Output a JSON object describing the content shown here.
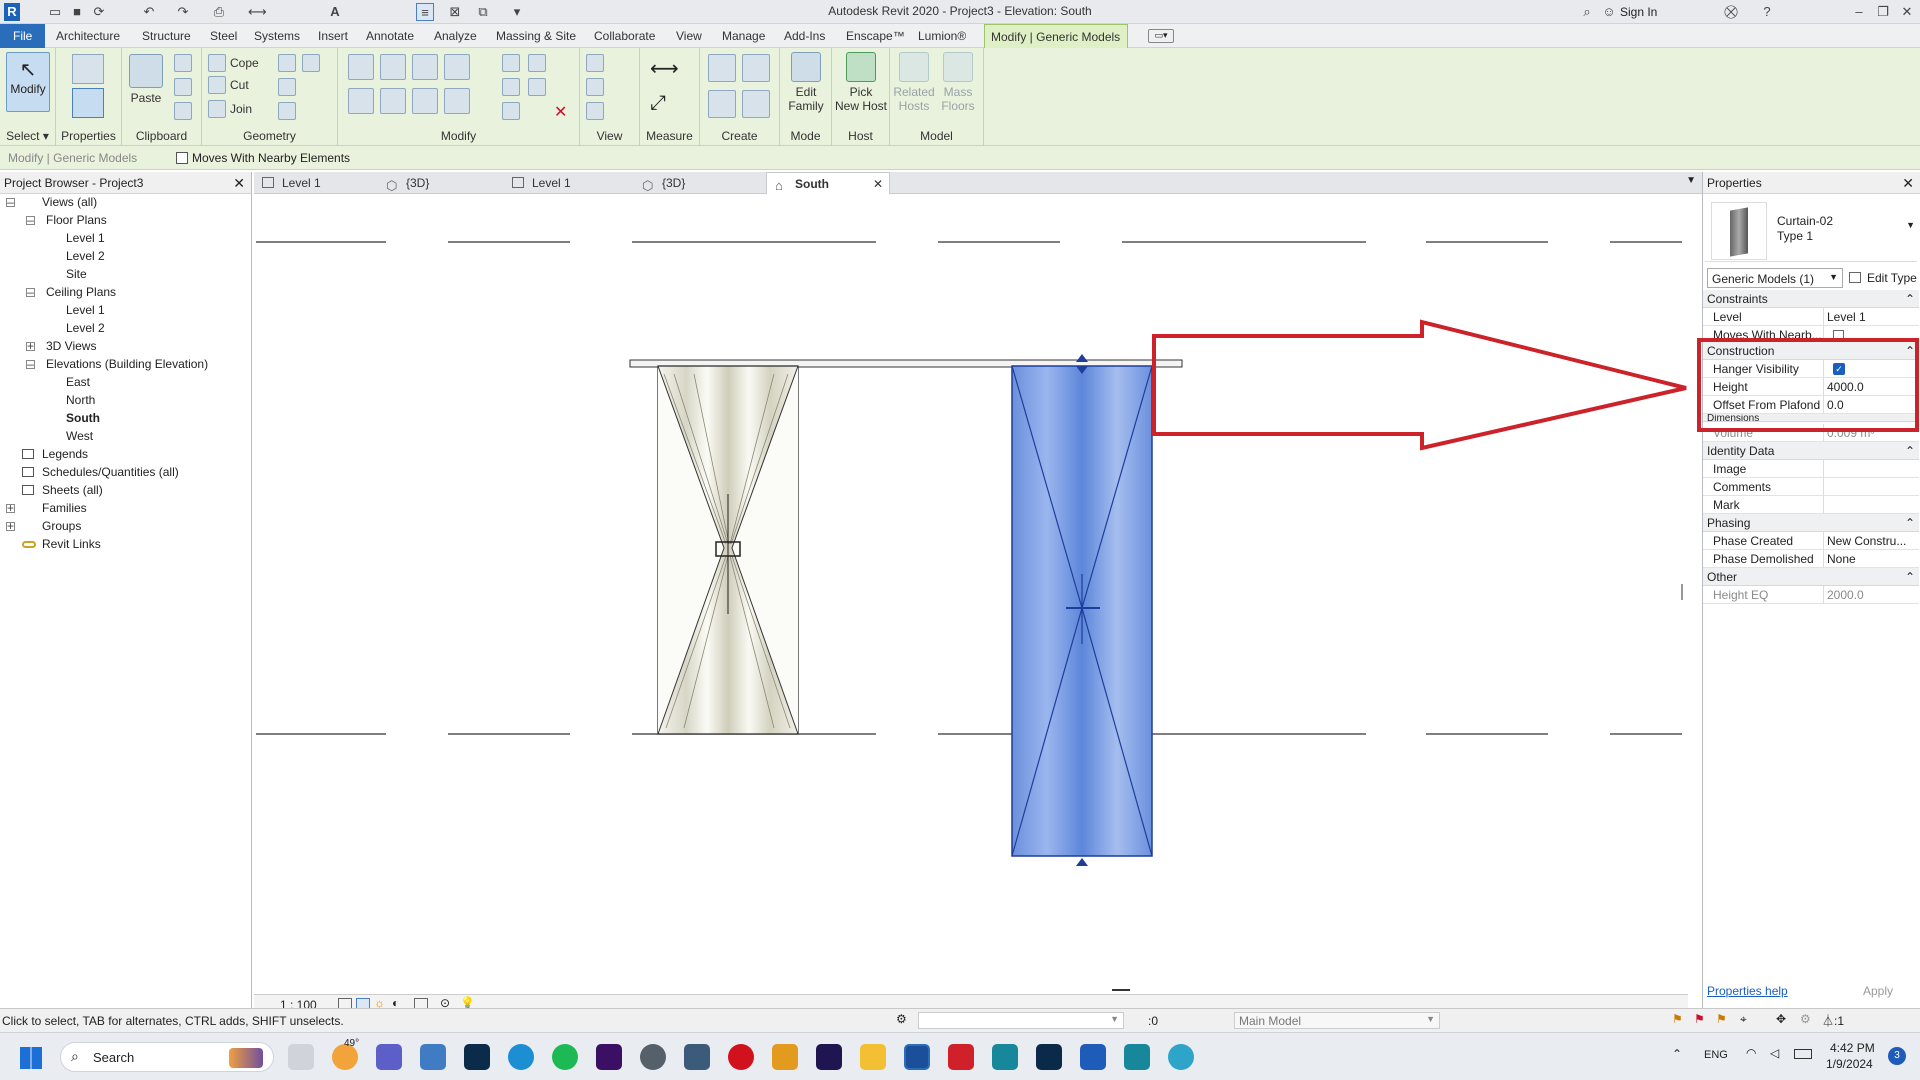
{
  "window": {
    "title": "Autodesk Revit 2020 - Project3 - Elevation: South",
    "sign_in": "Sign In"
  },
  "menu": {
    "tabs": [
      "File",
      "Architecture",
      "Structure",
      "Steel",
      "Systems",
      "Insert",
      "Annotate",
      "Analyze",
      "Massing & Site",
      "Collaborate",
      "View",
      "Manage",
      "Add-Ins",
      "Enscape™",
      "Lumion®",
      "Modify | Generic Models"
    ]
  },
  "ribbon": {
    "modify": "Modify",
    "select": "Select",
    "properties": "Properties",
    "paste": "Paste",
    "clipboard": "Clipboard",
    "cope": "Cope",
    "cut": "Cut",
    "join": "Join",
    "geometry": "Geometry",
    "modify_group": "Modify",
    "view": "View",
    "measure": "Measure",
    "create": "Create",
    "edit_family_1": "Edit",
    "edit_family_2": "Family",
    "mode": "Mode",
    "pick_host_1": "Pick",
    "pick_host_2": "New Host",
    "host": "Host",
    "related_hosts_1": "Related",
    "related_hosts_2": "Hosts",
    "mass_floors_1": "Mass",
    "mass_floors_2": "Floors",
    "model": "Model"
  },
  "options_bar": {
    "context": "Modify | Generic Models",
    "moves_with": "Moves With Nearby Elements"
  },
  "project_browser": {
    "title": "Project Browser - Project3",
    "items": {
      "views_all": "Views (all)",
      "floor_plans": "Floor Plans",
      "fp_level1": "Level 1",
      "fp_level2": "Level 2",
      "fp_site": "Site",
      "ceiling_plans": "Ceiling Plans",
      "cp_level1": "Level 1",
      "cp_level2": "Level 2",
      "views3d": "3D Views",
      "elevations": "Elevations (Building Elevation)",
      "east": "East",
      "north": "North",
      "south": "South",
      "west": "West",
      "legends": "Legends",
      "schedules": "Schedules/Quantities (all)",
      "sheets": "Sheets (all)",
      "families": "Families",
      "groups": "Groups",
      "revit_links": "Revit Links"
    }
  },
  "view_tabs": [
    "Level 1",
    "{3D}",
    "Level 1",
    "{3D}",
    "South"
  ],
  "view_control": {
    "scale": "1 : 100"
  },
  "properties": {
    "title": "Properties",
    "family": "Curtain-02",
    "type": "Type 1",
    "selector": "Generic Models (1)",
    "edit_type": "Edit Type",
    "constraints": "Constraints",
    "level_k": "Level",
    "level_v": "Level 1",
    "moves_k": "Moves With Nearb...",
    "construction": "Construction",
    "hanger_k": "Hanger Visibility",
    "height_k": "Height",
    "height_v": "4000.0",
    "offset_k": "Offset From Plafond",
    "offset_v": "0.0",
    "dimensions": "Dimensions",
    "volume_k": "Volume",
    "volume_v": "0.009 m³",
    "identity": "Identity Data",
    "image_k": "Image",
    "comments_k": "Comments",
    "mark_k": "Mark",
    "phasing": "Phasing",
    "phase_created_k": "Phase Created",
    "phase_created_v": "New Constru...",
    "phase_demolished_k": "Phase Demolished",
    "phase_demolished_v": "None",
    "other": "Other",
    "height_eq_k": "Height EQ",
    "height_eq_v": "2000.0",
    "help": "Properties help",
    "apply": "Apply"
  },
  "status": {
    "hint": "Click to select, TAB for alternates, CTRL adds, SHIFT unselects.",
    "worksets": ":0",
    "model": "Main Model",
    "filter": ":1"
  },
  "taskbar": {
    "search": "Search",
    "temp": "49°",
    "lang": "ENG",
    "time": "4:42 PM",
    "date": "1/9/2024",
    "badge": "3"
  }
}
